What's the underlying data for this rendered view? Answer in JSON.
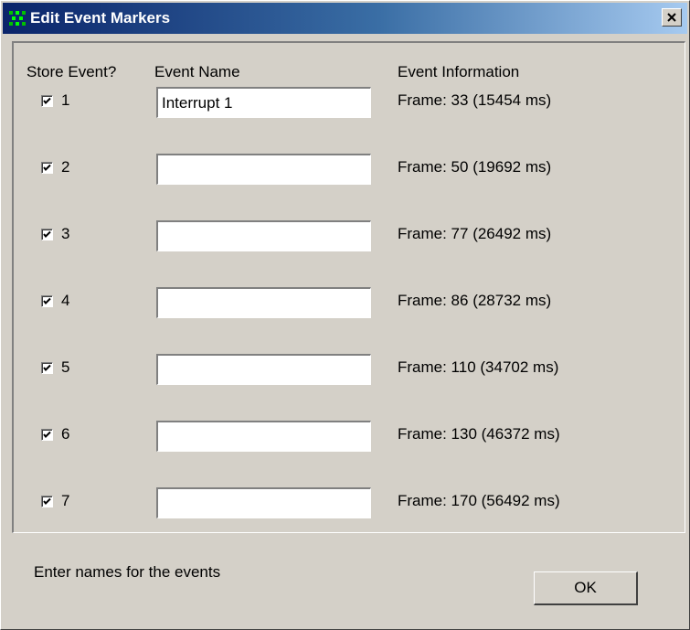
{
  "window": {
    "title": "Edit Event Markers",
    "icon": "app-icon",
    "close_icon": "close-icon"
  },
  "headers": {
    "store": "Store Event?",
    "name": "Event Name",
    "info": "Event Information"
  },
  "rows": [
    {
      "num": "1",
      "checked": true,
      "name_value": "Interrupt 1",
      "info": "Frame: 33 (15454 ms)"
    },
    {
      "num": "2",
      "checked": true,
      "name_value": "",
      "info": "Frame: 50 (19692 ms)"
    },
    {
      "num": "3",
      "checked": true,
      "name_value": "",
      "info": "Frame: 77 (26492 ms)"
    },
    {
      "num": "4",
      "checked": true,
      "name_value": "",
      "info": "Frame: 86 (28732 ms)"
    },
    {
      "num": "5",
      "checked": true,
      "name_value": "",
      "info": "Frame: 110 (34702 ms)"
    },
    {
      "num": "6",
      "checked": true,
      "name_value": "",
      "info": "Frame: 130 (46372 ms)"
    },
    {
      "num": "7",
      "checked": true,
      "name_value": "",
      "info": "Frame: 170 (56492 ms)"
    }
  ],
  "status": "Enter names for the events",
  "ok_label": "OK"
}
